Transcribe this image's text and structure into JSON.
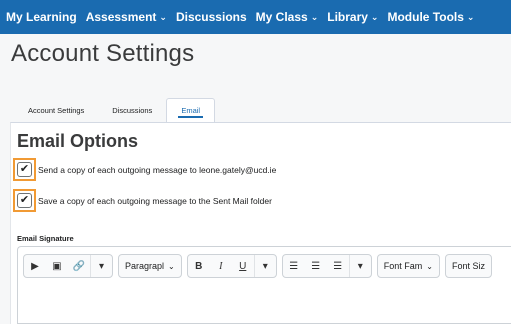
{
  "nav": {
    "items": [
      {
        "label": "My Learning",
        "dropdown": false
      },
      {
        "label": "Assessment",
        "dropdown": true
      },
      {
        "label": "Discussions",
        "dropdown": false
      },
      {
        "label": "My Class",
        "dropdown": true
      },
      {
        "label": "Library",
        "dropdown": true
      },
      {
        "label": "Module Tools",
        "dropdown": true
      }
    ],
    "caret": "⌄"
  },
  "page": {
    "title": "Account Settings"
  },
  "tabs": [
    {
      "label": "Account Settings",
      "active": false
    },
    {
      "label": "Discussions",
      "active": false
    },
    {
      "label": "Email",
      "active": true
    }
  ],
  "email_options": {
    "title": "Email Options",
    "options": [
      {
        "label": "Send a copy of each outgoing message to leone.gately@ucd.ie",
        "checked": true,
        "check_glyph": "✔"
      },
      {
        "label": "Save a copy of each outgoing message to the Sent Mail folder",
        "checked": true,
        "check_glyph": "✔"
      }
    ]
  },
  "signature": {
    "label": "Email Signature",
    "toolbar": {
      "insert_group": [
        "▶",
        "▣",
        "🔗",
        "▾"
      ],
      "paragraph": "Paragrapl",
      "format_group": [
        "B",
        "I",
        "U",
        "▾"
      ],
      "align_group": [
        "☰",
        "☰",
        "☰",
        "▾"
      ],
      "font_family": "Font Fam",
      "font_size": "Font Siz",
      "caret": "⌄"
    }
  },
  "colors": {
    "nav_bg": "#1a6bb0",
    "highlight": "#f19a34",
    "active_tab": "#1a6bb0"
  }
}
